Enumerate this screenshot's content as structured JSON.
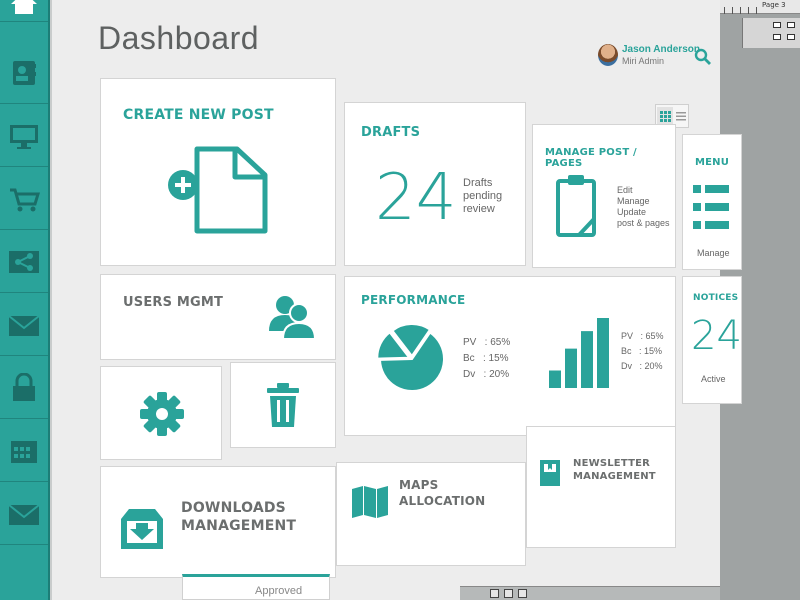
{
  "page": {
    "title": "Dashboard"
  },
  "chrome": {
    "page_label": "Page 3"
  },
  "colors": {
    "accent": "#2aa39a",
    "sidebar": "#2aa39a",
    "tile_bg": "#ffffff",
    "canvas_bg": "#ededed"
  },
  "user": {
    "name": "Jason Anderson",
    "role": "Miri Admin"
  },
  "sidebar": {
    "items": [
      {
        "icon": "home-icon"
      },
      {
        "icon": "contacts-icon"
      },
      {
        "icon": "monitor-icon"
      },
      {
        "icon": "cart-icon"
      },
      {
        "icon": "share-icon"
      },
      {
        "icon": "mail-icon"
      },
      {
        "icon": "lock-icon"
      },
      {
        "icon": "calendar-icon"
      },
      {
        "icon": "mail-icon"
      }
    ]
  },
  "tiles": {
    "create_post": {
      "title": "CREATE NEW POST",
      "icon": "new-document-icon"
    },
    "drafts": {
      "title": "DRAFTS",
      "count": "24",
      "desc": [
        "Drafts",
        "pending",
        "review"
      ]
    },
    "manage_post": {
      "title": "MANAGE POST / PAGES",
      "desc": [
        "Edit",
        "Manage",
        "Update",
        "post & pages"
      ],
      "icon": "clipboard-icon"
    },
    "menu": {
      "title": "MENU",
      "desc": "Manage",
      "icon": "list-icon"
    },
    "users": {
      "title": "USERS MGMT",
      "icon": "users-icon"
    },
    "performance": {
      "title": "PERFORMANCE",
      "stats_left": [
        "PV   : 65%",
        "Bc   : 15%",
        "Dv   : 20%"
      ],
      "stats_right": [
        "PV   : 65%",
        "Bc   : 15%",
        "Dv   : 20%"
      ]
    },
    "notices": {
      "title": "NOTICES",
      "count": "24",
      "desc": "Active"
    },
    "settings": {
      "icon": "gear-icon"
    },
    "trash": {
      "icon": "trash-icon"
    },
    "downloads": {
      "title_line1": "DOWNLOADS",
      "title_line2": "MANAGEMENT",
      "icon": "download-box-icon"
    },
    "maps": {
      "title_line1": "MAPS",
      "title_line2": "ALLOCATION",
      "icon": "map-icon"
    },
    "newsletter": {
      "title_line1": "NEWSLETTER",
      "title_line2": "MANAGEMENT",
      "icon": "newsletter-icon"
    }
  },
  "bottom_tab": {
    "label": "Approved"
  },
  "chart_data": [
    {
      "type": "pie",
      "values": [
        65,
        15,
        20
      ],
      "categories": [
        "PV",
        "Bc",
        "Dv"
      ]
    },
    {
      "type": "bar",
      "values": [
        20,
        45,
        65,
        80
      ]
    }
  ]
}
